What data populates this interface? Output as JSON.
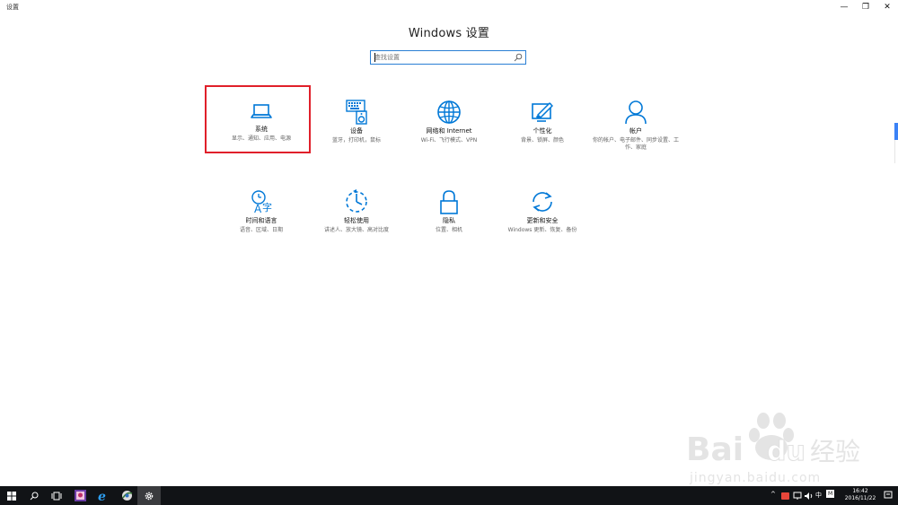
{
  "window": {
    "app_title": "设置",
    "minimize_glyph": "—",
    "maximize_glyph": "❐",
    "close_glyph": "✕"
  },
  "header": {
    "title": "Windows 设置"
  },
  "search": {
    "placeholder": "查找设置",
    "value": ""
  },
  "tiles": [
    {
      "name": "系统",
      "desc": "显示、通知、应用、电源",
      "icon": "laptop-icon",
      "selected": true
    },
    {
      "name": "设备",
      "desc": "蓝牙，打印机，鼠标",
      "icon": "keyboard-speaker-icon"
    },
    {
      "name": "网络和 Internet",
      "desc": "Wi-Fi、飞行模式、VPN",
      "icon": "globe-icon"
    },
    {
      "name": "个性化",
      "desc": "背景、锁屏、颜色",
      "icon": "paint-brush-icon"
    },
    {
      "name": "帐户",
      "desc": "你的帐户、电子邮件、同步设置、工作、家庭",
      "icon": "person-icon"
    },
    {
      "name": "时间和语言",
      "desc": "语音、区域、日期",
      "icon": "time-language-icon"
    },
    {
      "name": "轻松使用",
      "desc": "讲述人、放大镜、高对比度",
      "icon": "ease-of-access-icon"
    },
    {
      "name": "隐私",
      "desc": "位置、相机",
      "icon": "lock-icon"
    },
    {
      "name": "更新和安全",
      "desc": "Windows 更新、恢复、备份",
      "icon": "sync-icon"
    }
  ],
  "accent_color": "#0078d7",
  "highlight_color": "#e0202a",
  "taskbar": {
    "items": [
      "start-icon",
      "search-icon",
      "task-view-icon",
      "photos-app-icon",
      "edge-icon",
      "browser-app-icon",
      "settings-icon"
    ],
    "tray": {
      "ime": "中",
      "ime_mode": "M"
    },
    "clock": {
      "time": "16:42",
      "date": "2016/11/22"
    }
  },
  "watermark": {
    "brand": "Bai",
    "brand_suffix": "经验",
    "url": "jingyan.baidu.com"
  }
}
